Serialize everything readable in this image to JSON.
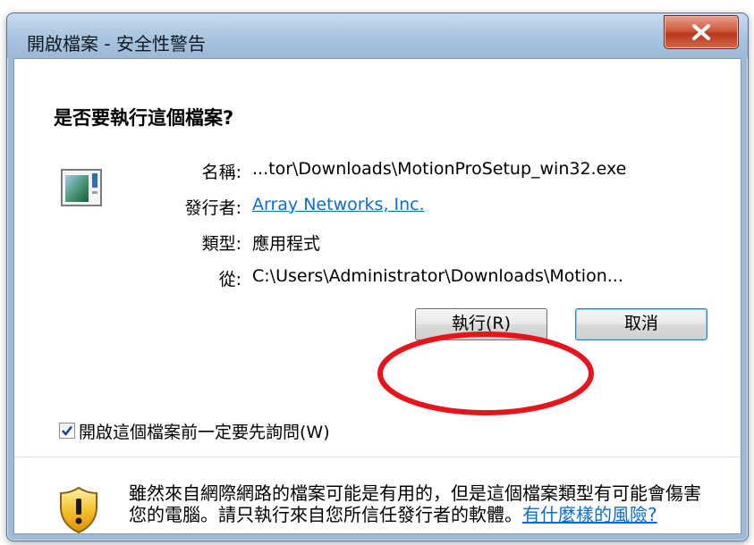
{
  "window": {
    "title": "開啟檔案 - 安全性警告",
    "close_label": "X"
  },
  "dialog": {
    "question": "是否要執行這個檔案?",
    "fields": [
      {
        "label": "名稱:",
        "value": "...tor\\Downloads\\MotionProSetup_win32.exe"
      },
      {
        "label": "發行者:",
        "value": "Array Networks, Inc."
      },
      {
        "label": "類型:",
        "value": "應用程式"
      },
      {
        "label": "從:",
        "value": "C:\\Users\\Administrator\\Downloads\\Motion..."
      }
    ],
    "run_button": "執行(R)",
    "cancel_button": "取消",
    "checkbox": {
      "label": "開啟這個檔案前一定要先詢問(W)",
      "checked": true
    },
    "warning": {
      "text": "雖然來自網際網路的檔案可能是有用的，但是這個檔案類型有可能會傷害您的電腦。請只執行來自您所信任發行者的軟體。",
      "link": "有什麼樣的風險?"
    }
  },
  "colors": {
    "link": "#0a6ed1",
    "annotation_ellipse": "#e8141b",
    "close_button": "#c8462b"
  },
  "icons": [
    "application-icon",
    "close-icon",
    "checkmark-icon",
    "shield-warning-icon"
  ]
}
